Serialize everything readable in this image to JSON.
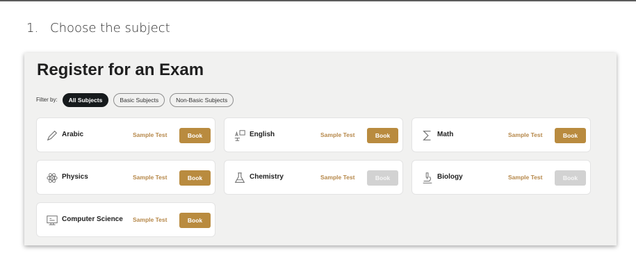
{
  "step": {
    "number": "1.",
    "text": "Choose the subject"
  },
  "panel": {
    "title": "Register for an Exam",
    "filter_label": "Filter by:",
    "filters": [
      "All Subjects",
      "Basic Subjects",
      "Non-Basic Subjects"
    ],
    "active_filter": "All Subjects"
  },
  "subjects": [
    {
      "name": "Arabic",
      "sample": "Sample Test",
      "book": "Book",
      "book_enabled": true,
      "icon": "pen-icon"
    },
    {
      "name": "English",
      "sample": "Sample Test",
      "book": "Book",
      "book_enabled": true,
      "icon": "language-icon"
    },
    {
      "name": "Math",
      "sample": "Sample Test",
      "book": "Book",
      "book_enabled": true,
      "icon": "sigma-icon"
    },
    {
      "name": "Physics",
      "sample": "Sample Test",
      "book": "Book",
      "book_enabled": true,
      "icon": "atom-icon"
    },
    {
      "name": "Chemistry",
      "sample": "Sample Test",
      "book": "Book",
      "book_enabled": false,
      "icon": "flask-icon"
    },
    {
      "name": "Biology",
      "sample": "Sample Test",
      "book": "Book",
      "book_enabled": false,
      "icon": "microscope-icon"
    },
    {
      "name": "Computer Science",
      "sample": "Sample Test",
      "book": "Book",
      "book_enabled": true,
      "icon": "computer-icon"
    }
  ],
  "colors": {
    "accent": "#b98b3f",
    "sample_text": "#b6884a",
    "active_chip": "#161a1c",
    "disabled_button": "#d2d2d2"
  }
}
